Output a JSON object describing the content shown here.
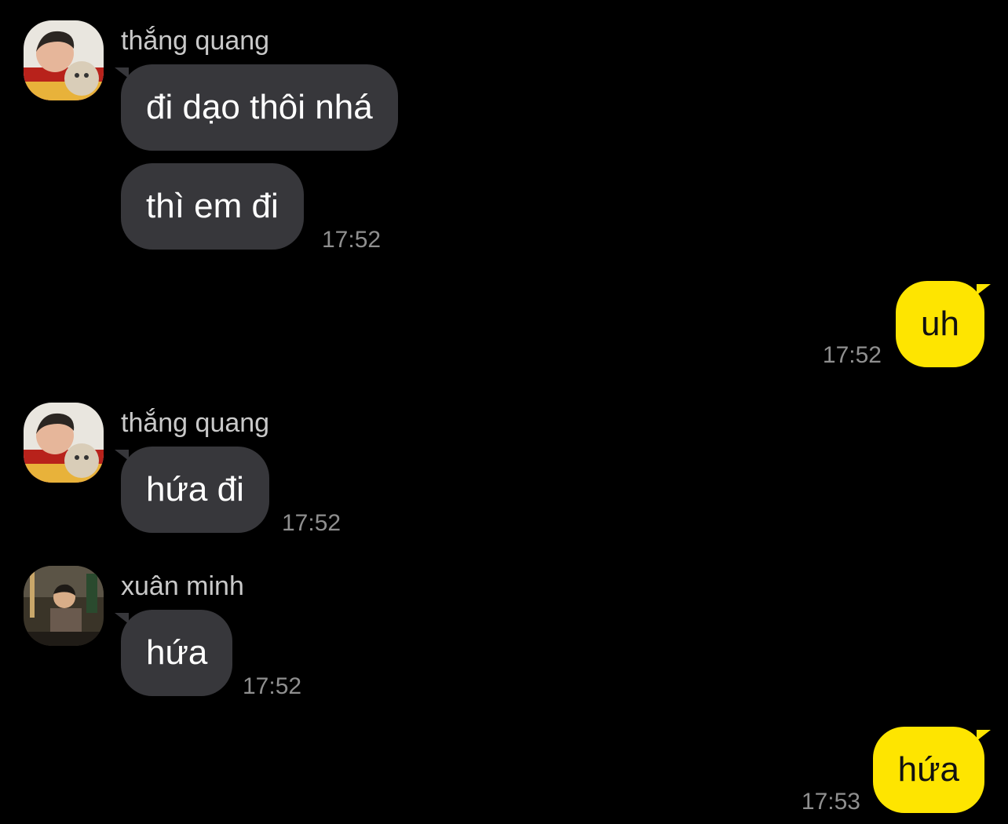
{
  "colors": {
    "background": "#000000",
    "incoming_bubble": "#37373b",
    "outgoing_bubble": "#fee500",
    "name_text": "#c9c9c9",
    "time_text": "#8f8f8f"
  },
  "messages": [
    {
      "sender": "thắng quang",
      "avatar": "avatar-thang-quang",
      "bubbles": [
        {
          "text": "đi dạo thôi nhá"
        },
        {
          "text": "thì em đi",
          "time": "17:52"
        }
      ]
    },
    {
      "outgoing": true,
      "text": "uh",
      "time": "17:52"
    },
    {
      "sender": "thắng quang",
      "avatar": "avatar-thang-quang",
      "bubbles": [
        {
          "text": "hứa đi",
          "time": "17:52"
        }
      ]
    },
    {
      "sender": "xuân minh",
      "avatar": "avatar-xuan-minh",
      "bubbles": [
        {
          "text": "hứa",
          "time": "17:52"
        }
      ]
    },
    {
      "outgoing": true,
      "text": "hứa",
      "time": "17:53"
    }
  ]
}
